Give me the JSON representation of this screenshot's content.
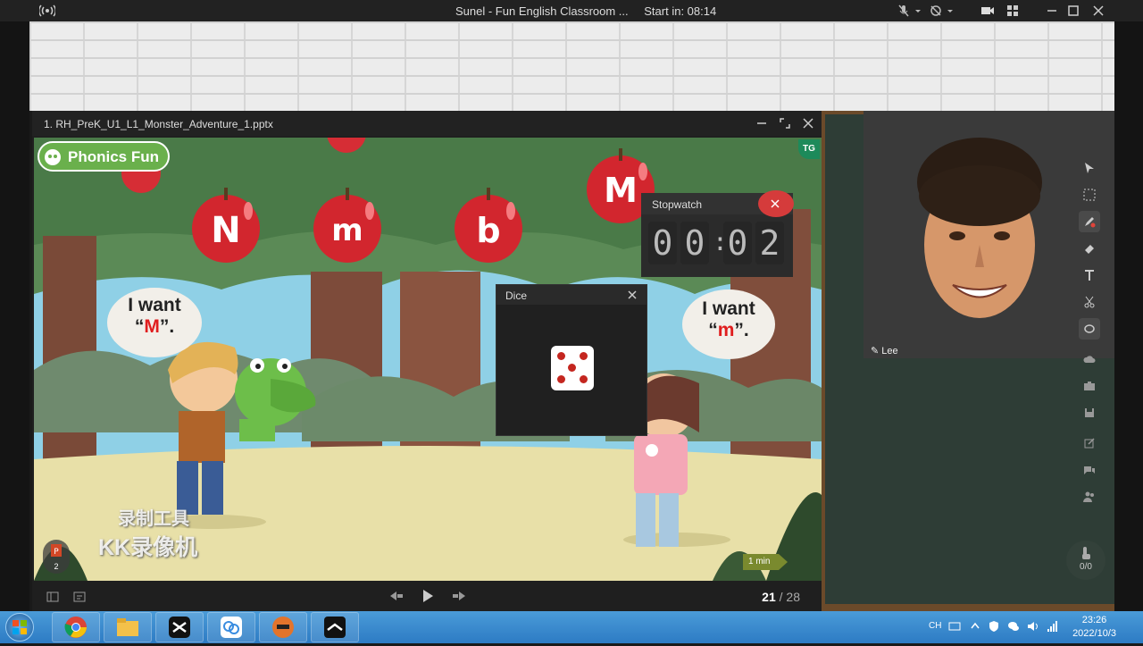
{
  "window": {
    "title": "Sunel - Fun English Classroom ...",
    "start_label": "Start in: 08:14"
  },
  "presentation": {
    "file_name": "1. RH_PreK_U1_L1_Monster_Adventure_1.pptx",
    "page_current": "21",
    "page_separator": " / ",
    "page_total": "28"
  },
  "slide": {
    "logo": "Phonics Fun",
    "corner_badge": "TG",
    "apples": [
      "N",
      "m",
      "b",
      "M"
    ],
    "left_bubble": {
      "line1": "I want",
      "open_quote": "“",
      "letter": "M",
      "close_quote": "”."
    },
    "right_bubble": {
      "line1": "I want",
      "open_quote": "“",
      "letter": "m",
      "close_quote": "”."
    },
    "timer_tag": "1 min",
    "watermark_line1": "录制工具",
    "watermark_line2": "KK录像机",
    "slide_count": "2"
  },
  "dice": {
    "title": "Dice",
    "value": 5
  },
  "stopwatch": {
    "title": "Stopwatch",
    "digits": [
      "0",
      "0",
      "0",
      "2"
    ]
  },
  "participant": {
    "name": "Lee"
  },
  "toolbar": {
    "user_count": "0/0"
  },
  "taskbar": {
    "lang": "CH",
    "time": "23:26",
    "date": "2022/10/3",
    "apps": [
      "chrome-icon",
      "file-explorer-icon",
      "capcut-icon",
      "recorder-icon",
      "game-icon",
      "classin-icon"
    ]
  },
  "colors": {
    "accent_red": "#e01e1e",
    "board": "#2e3d36",
    "taskbar": "#2d7bc4",
    "sky": "#8fd0e6"
  }
}
